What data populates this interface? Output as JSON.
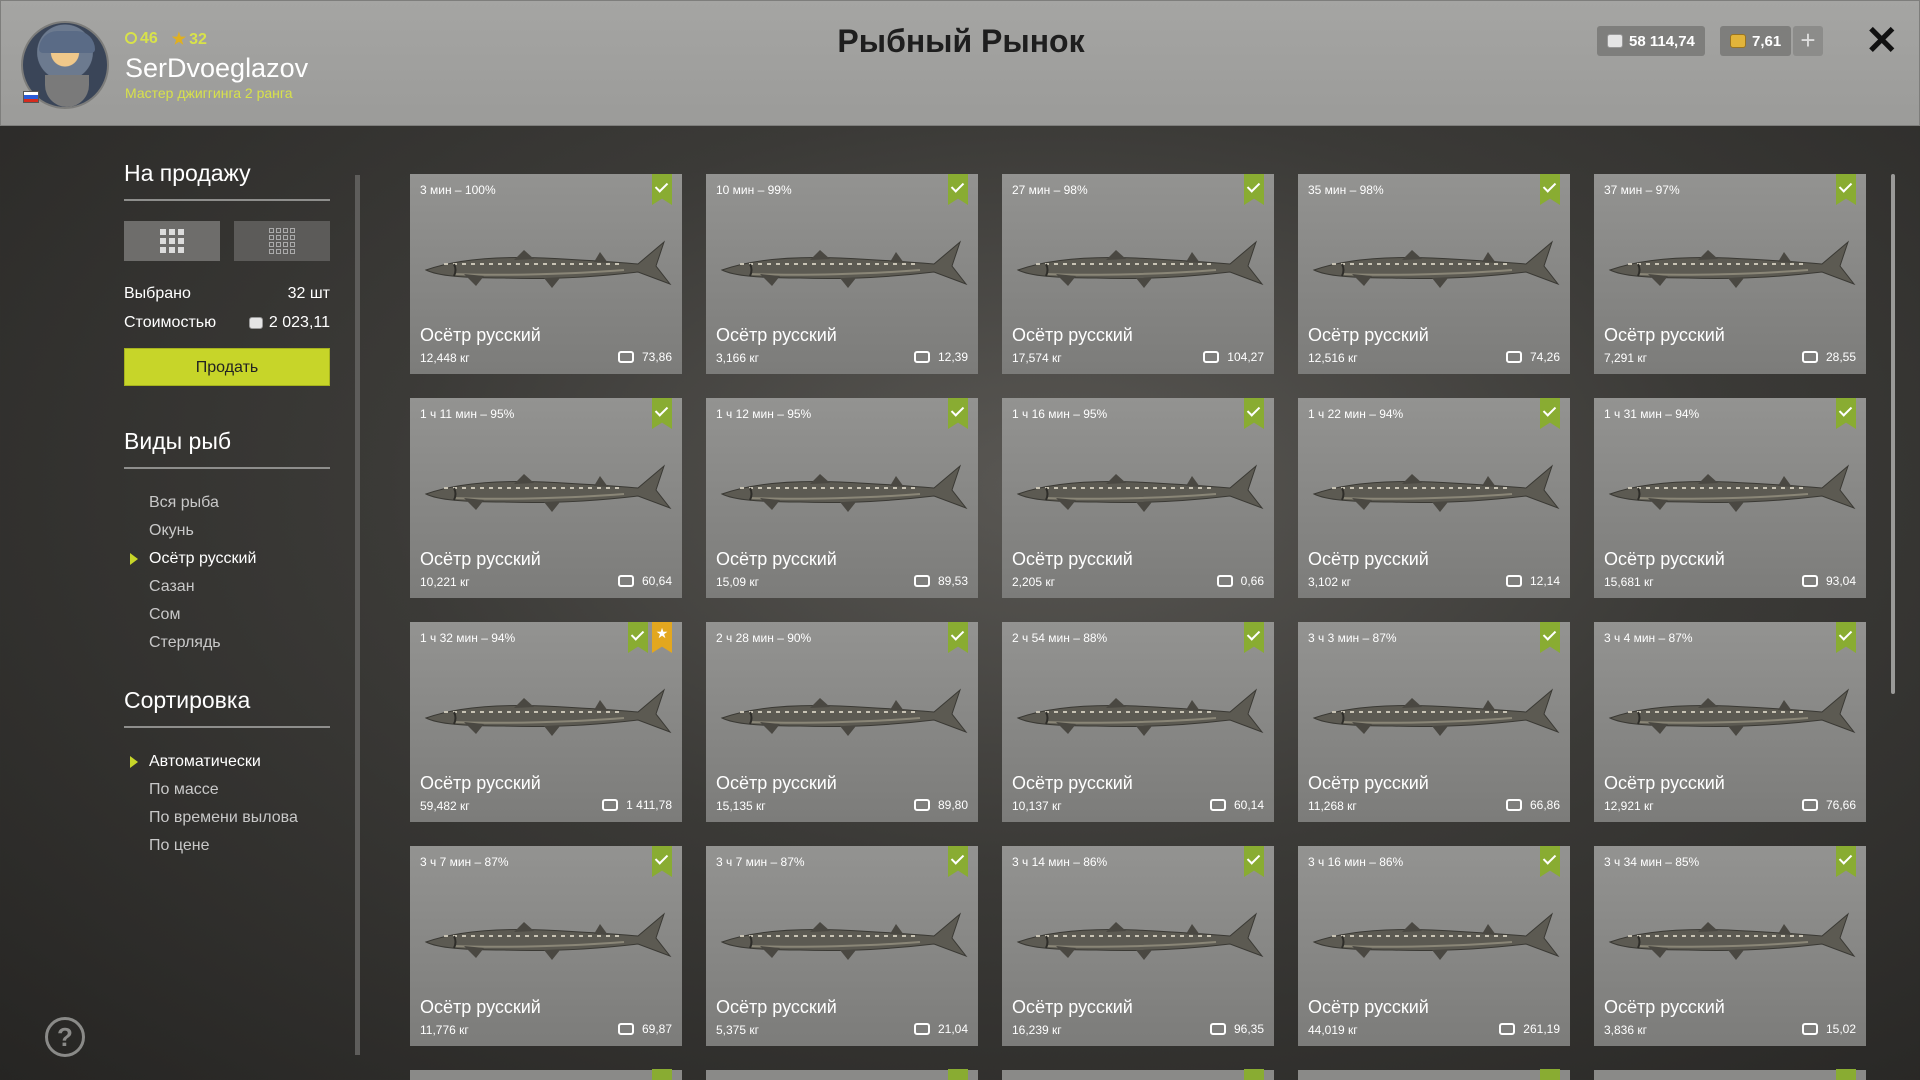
{
  "header": {
    "title": "Рыбный Рынок",
    "player": {
      "level": "46",
      "stars": "32",
      "name": "SerDvoeglazov",
      "rank": "Мастер джиггинга 2 ранга"
    },
    "silver": "58 114,74",
    "gold": "7,61",
    "plus": "+",
    "close": "✕"
  },
  "sidebar": {
    "for_sale_title": "На продажу",
    "selected_label": "Выбрано",
    "selected_value": "32 шт",
    "cost_label": "Стоимостью",
    "cost_value": "2 023,11",
    "sell_label": "Продать",
    "species_title": "Виды рыб",
    "species": [
      "Вся рыба",
      "Окунь",
      "Осётр русский",
      "Сазан",
      "Сом",
      "Стерлядь"
    ],
    "species_active": 2,
    "sort_title": "Сортировка",
    "sorts": [
      "Автоматически",
      "По массе",
      "По времени вылова",
      "По цене"
    ],
    "sort_active": 0,
    "help": "?"
  },
  "cards": [
    {
      "time": "3 мин – 100%",
      "name": "Осётр русский",
      "weight": "12,448 кг",
      "price": "73,86",
      "star": false
    },
    {
      "time": "10 мин – 99%",
      "name": "Осётр русский",
      "weight": "3,166 кг",
      "price": "12,39",
      "star": false
    },
    {
      "time": "27 мин – 98%",
      "name": "Осётр русский",
      "weight": "17,574 кг",
      "price": "104,27",
      "star": false
    },
    {
      "time": "35 мин – 98%",
      "name": "Осётр русский",
      "weight": "12,516 кг",
      "price": "74,26",
      "star": false
    },
    {
      "time": "37 мин – 97%",
      "name": "Осётр русский",
      "weight": "7,291 кг",
      "price": "28,55",
      "star": false
    },
    {
      "time": "1 ч 11 мин – 95%",
      "name": "Осётр русский",
      "weight": "10,221 кг",
      "price": "60,64",
      "star": false
    },
    {
      "time": "1 ч 12 мин – 95%",
      "name": "Осётр русский",
      "weight": "15,09 кг",
      "price": "89,53",
      "star": false
    },
    {
      "time": "1 ч 16 мин – 95%",
      "name": "Осётр русский",
      "weight": "2,205 кг",
      "price": "0,66",
      "star": false
    },
    {
      "time": "1 ч 22 мин – 94%",
      "name": "Осётр русский",
      "weight": "3,102 кг",
      "price": "12,14",
      "star": false
    },
    {
      "time": "1 ч 31 мин – 94%",
      "name": "Осётр русский",
      "weight": "15,681 кг",
      "price": "93,04",
      "star": false
    },
    {
      "time": "1 ч 32 мин – 94%",
      "name": "Осётр русский",
      "weight": "59,482 кг",
      "price": "1 411,78",
      "star": true
    },
    {
      "time": "2 ч 28 мин – 90%",
      "name": "Осётр русский",
      "weight": "15,135 кг",
      "price": "89,80",
      "star": false
    },
    {
      "time": "2 ч 54 мин – 88%",
      "name": "Осётр русский",
      "weight": "10,137 кг",
      "price": "60,14",
      "star": false
    },
    {
      "time": "3 ч 3 мин – 87%",
      "name": "Осётр русский",
      "weight": "11,268 кг",
      "price": "66,86",
      "star": false
    },
    {
      "time": "3 ч 4 мин – 87%",
      "name": "Осётр русский",
      "weight": "12,921 кг",
      "price": "76,66",
      "star": false
    },
    {
      "time": "3 ч 7 мин – 87%",
      "name": "Осётр русский",
      "weight": "11,776 кг",
      "price": "69,87",
      "star": false
    },
    {
      "time": "3 ч 7 мин – 87%",
      "name": "Осётр русский",
      "weight": "5,375 кг",
      "price": "21,04",
      "star": false
    },
    {
      "time": "3 ч 14 мин – 86%",
      "name": "Осётр русский",
      "weight": "16,239 кг",
      "price": "96,35",
      "star": false
    },
    {
      "time": "3 ч 16 мин – 86%",
      "name": "Осётр русский",
      "weight": "44,019 кг",
      "price": "261,19",
      "star": false
    },
    {
      "time": "3 ч 34 мин – 85%",
      "name": "Осётр русский",
      "weight": "3,836 кг",
      "price": "15,02",
      "star": false
    }
  ],
  "colors": {
    "accent": "#c7d529",
    "check_badge": "#89ac32",
    "star_badge": "#e3a71f"
  }
}
